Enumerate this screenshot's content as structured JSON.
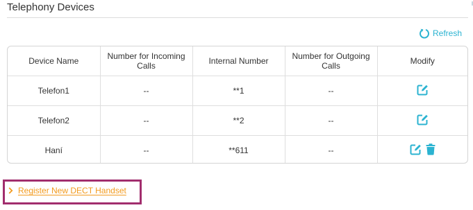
{
  "section": {
    "title": "Telephony Devices"
  },
  "toolbar": {
    "refresh_label": "Refresh",
    "refresh_icon": "refresh-icon"
  },
  "table": {
    "columns": [
      "Device Name",
      "Number for Incoming Calls",
      "Internal Number",
      "Number for Outgoing Calls",
      "Modify"
    ],
    "rows": [
      {
        "device_name": "Telefon1",
        "incoming": "--",
        "internal": "**1",
        "outgoing": "--",
        "actions": [
          "edit-icon"
        ]
      },
      {
        "device_name": "Telefon2",
        "incoming": "--",
        "internal": "**2",
        "outgoing": "--",
        "actions": [
          "edit-icon"
        ]
      },
      {
        "device_name": "Haní",
        "incoming": "--",
        "internal": "**611",
        "outgoing": "--",
        "actions": [
          "edit-icon",
          "trash-icon"
        ]
      }
    ]
  },
  "register": {
    "label": "Register New DECT Handset",
    "icon": "chevron-right-icon"
  },
  "colors": {
    "accent": "#2bb3d1",
    "link": "#f29a1d",
    "highlight_border": "#a12d6d"
  }
}
